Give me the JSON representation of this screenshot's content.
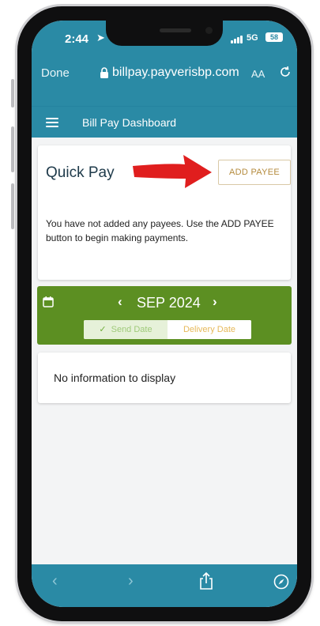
{
  "status": {
    "time": "2:44",
    "network": "5G",
    "battery": "58"
  },
  "browser": {
    "done_label": "Done",
    "url": "billpay.payverisbp.com",
    "text_size_label": "AA"
  },
  "app": {
    "title": "Bill Pay Dashboard"
  },
  "quick_pay": {
    "title": "Quick Pay",
    "add_payee_label": "ADD PAYEE",
    "message": "You have not added any payees. Use the ADD PAYEE button to begin making payments."
  },
  "calendar": {
    "prev": "‹",
    "next": "›",
    "month": "SEP 2024",
    "send_date_label": "Send Date",
    "delivery_date_label": "Delivery Date"
  },
  "empty_state": {
    "text": "No information to display"
  },
  "bottom_nav": {
    "back": "‹",
    "forward": "›"
  },
  "colors": {
    "header": "#2a8aa5",
    "calendar_bar": "#5c8f22",
    "arrow": "#e01e1e",
    "add_payee_text": "#b48a3c"
  },
  "icons": [
    "location-arrow-icon",
    "lock-icon",
    "reload-icon",
    "hamburger-icon",
    "red-arrow-icon",
    "calendar-icon",
    "check-icon",
    "share-icon",
    "compass-icon"
  ]
}
